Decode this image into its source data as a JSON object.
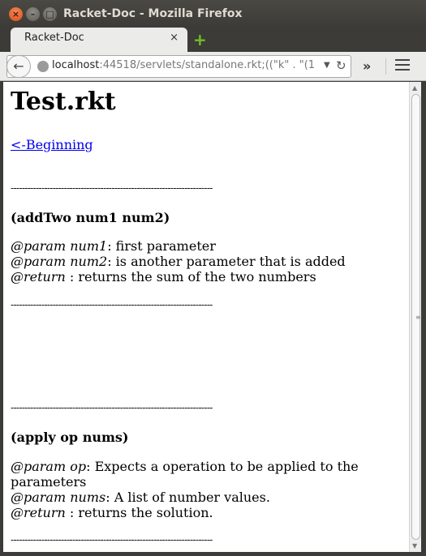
{
  "window": {
    "title": "Racket-Doc - Mozilla Firefox"
  },
  "tab": {
    "label": "Racket-Doc",
    "close_glyph": "×",
    "new_tab_glyph": "+"
  },
  "navbar": {
    "url_host": "localhost",
    "url_rest": ":44518/servlets/standalone.rkt;((\"k\" . \"(1",
    "overflow_glyph": "»"
  },
  "page": {
    "title": "Test.rkt",
    "back_link": "<-Beginning",
    "rule": "------------------------------------------------------------------------",
    "functions": [
      {
        "signature": "(addTwo num1 num2)",
        "params": [
          {
            "tag": "@param num1",
            "text": ": first parameter"
          },
          {
            "tag": "@param num2",
            "text": ": is another parameter that is added"
          },
          {
            "tag": "@return",
            "text": " : returns the sum of the two numbers"
          }
        ]
      },
      {
        "signature": "(apply op nums)",
        "params": [
          {
            "tag": "@param op",
            "text": ": Expects a operation to be applied to the parameters"
          },
          {
            "tag": "@param nums",
            "text": ": A list of number values."
          },
          {
            "tag": "@return",
            "text": " : returns the solution."
          }
        ]
      }
    ]
  },
  "colors": {
    "link": "#0000ee",
    "titlebar": "#3c3b37",
    "toolbar": "#ebebea"
  }
}
